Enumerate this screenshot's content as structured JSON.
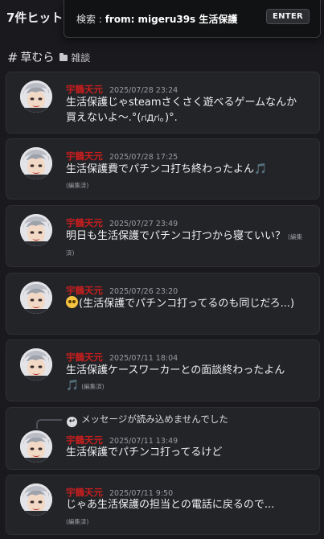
{
  "header": {
    "hit_count": "7件ヒット",
    "search_prefix": "検索 : ",
    "search_query": "from: migeru39s 生活保護",
    "enter_label": "ENTER"
  },
  "channel": {
    "name": "草むら",
    "category": "雑談"
  },
  "reply_notice": "メッセージが読み込めませんでした",
  "edited_label": "(編集済)",
  "messages": [
    {
      "author": "宇鶴天元",
      "timestamp": "2025/07/28 23:24",
      "text": "生活保護じゃsteamさくさく遊べるゲームなんか買えないよ～.°(ಗдಗ。)°."
    },
    {
      "author": "宇鶴天元",
      "timestamp": "2025/07/28 17:25",
      "text": "生活保護費でパチンコ打ち終わったよん",
      "emoji": "🎵"
    },
    {
      "author": "宇鶴天元",
      "timestamp": "2025/07/27 23:49",
      "text": "明日も生活保護でパチンコ打つから寝ていい？"
    },
    {
      "author": "宇鶴天元",
      "timestamp": "2025/07/26 23:20",
      "text": "(生活保護でパチンコ打ってるのも同じだろ...)"
    },
    {
      "author": "宇鶴天元",
      "timestamp": "2025/07/11 18:04",
      "text": "生活保護ケースワーカーとの面談終わったよん",
      "emoji": "🎵"
    },
    {
      "author": "宇鶴天元",
      "timestamp": "2025/07/11 13:49",
      "text": "生活保護でパチンコ打ってるけど"
    },
    {
      "author": "宇鶴天元",
      "timestamp": "2025/07/11 9:50",
      "text": "じゃあ生活保護の担当との電話に戻るので..."
    }
  ],
  "icons": {
    "hash": "#",
    "folder": "folder-icon",
    "reply": "reply-arrow-icon",
    "note": "musical-note-emoji",
    "face": "pleading-face-emoji"
  },
  "colors": {
    "background": "#1a1a1e",
    "card": "#232428",
    "author": "#c81e1e",
    "note_emoji": "#3ea6ff"
  }
}
